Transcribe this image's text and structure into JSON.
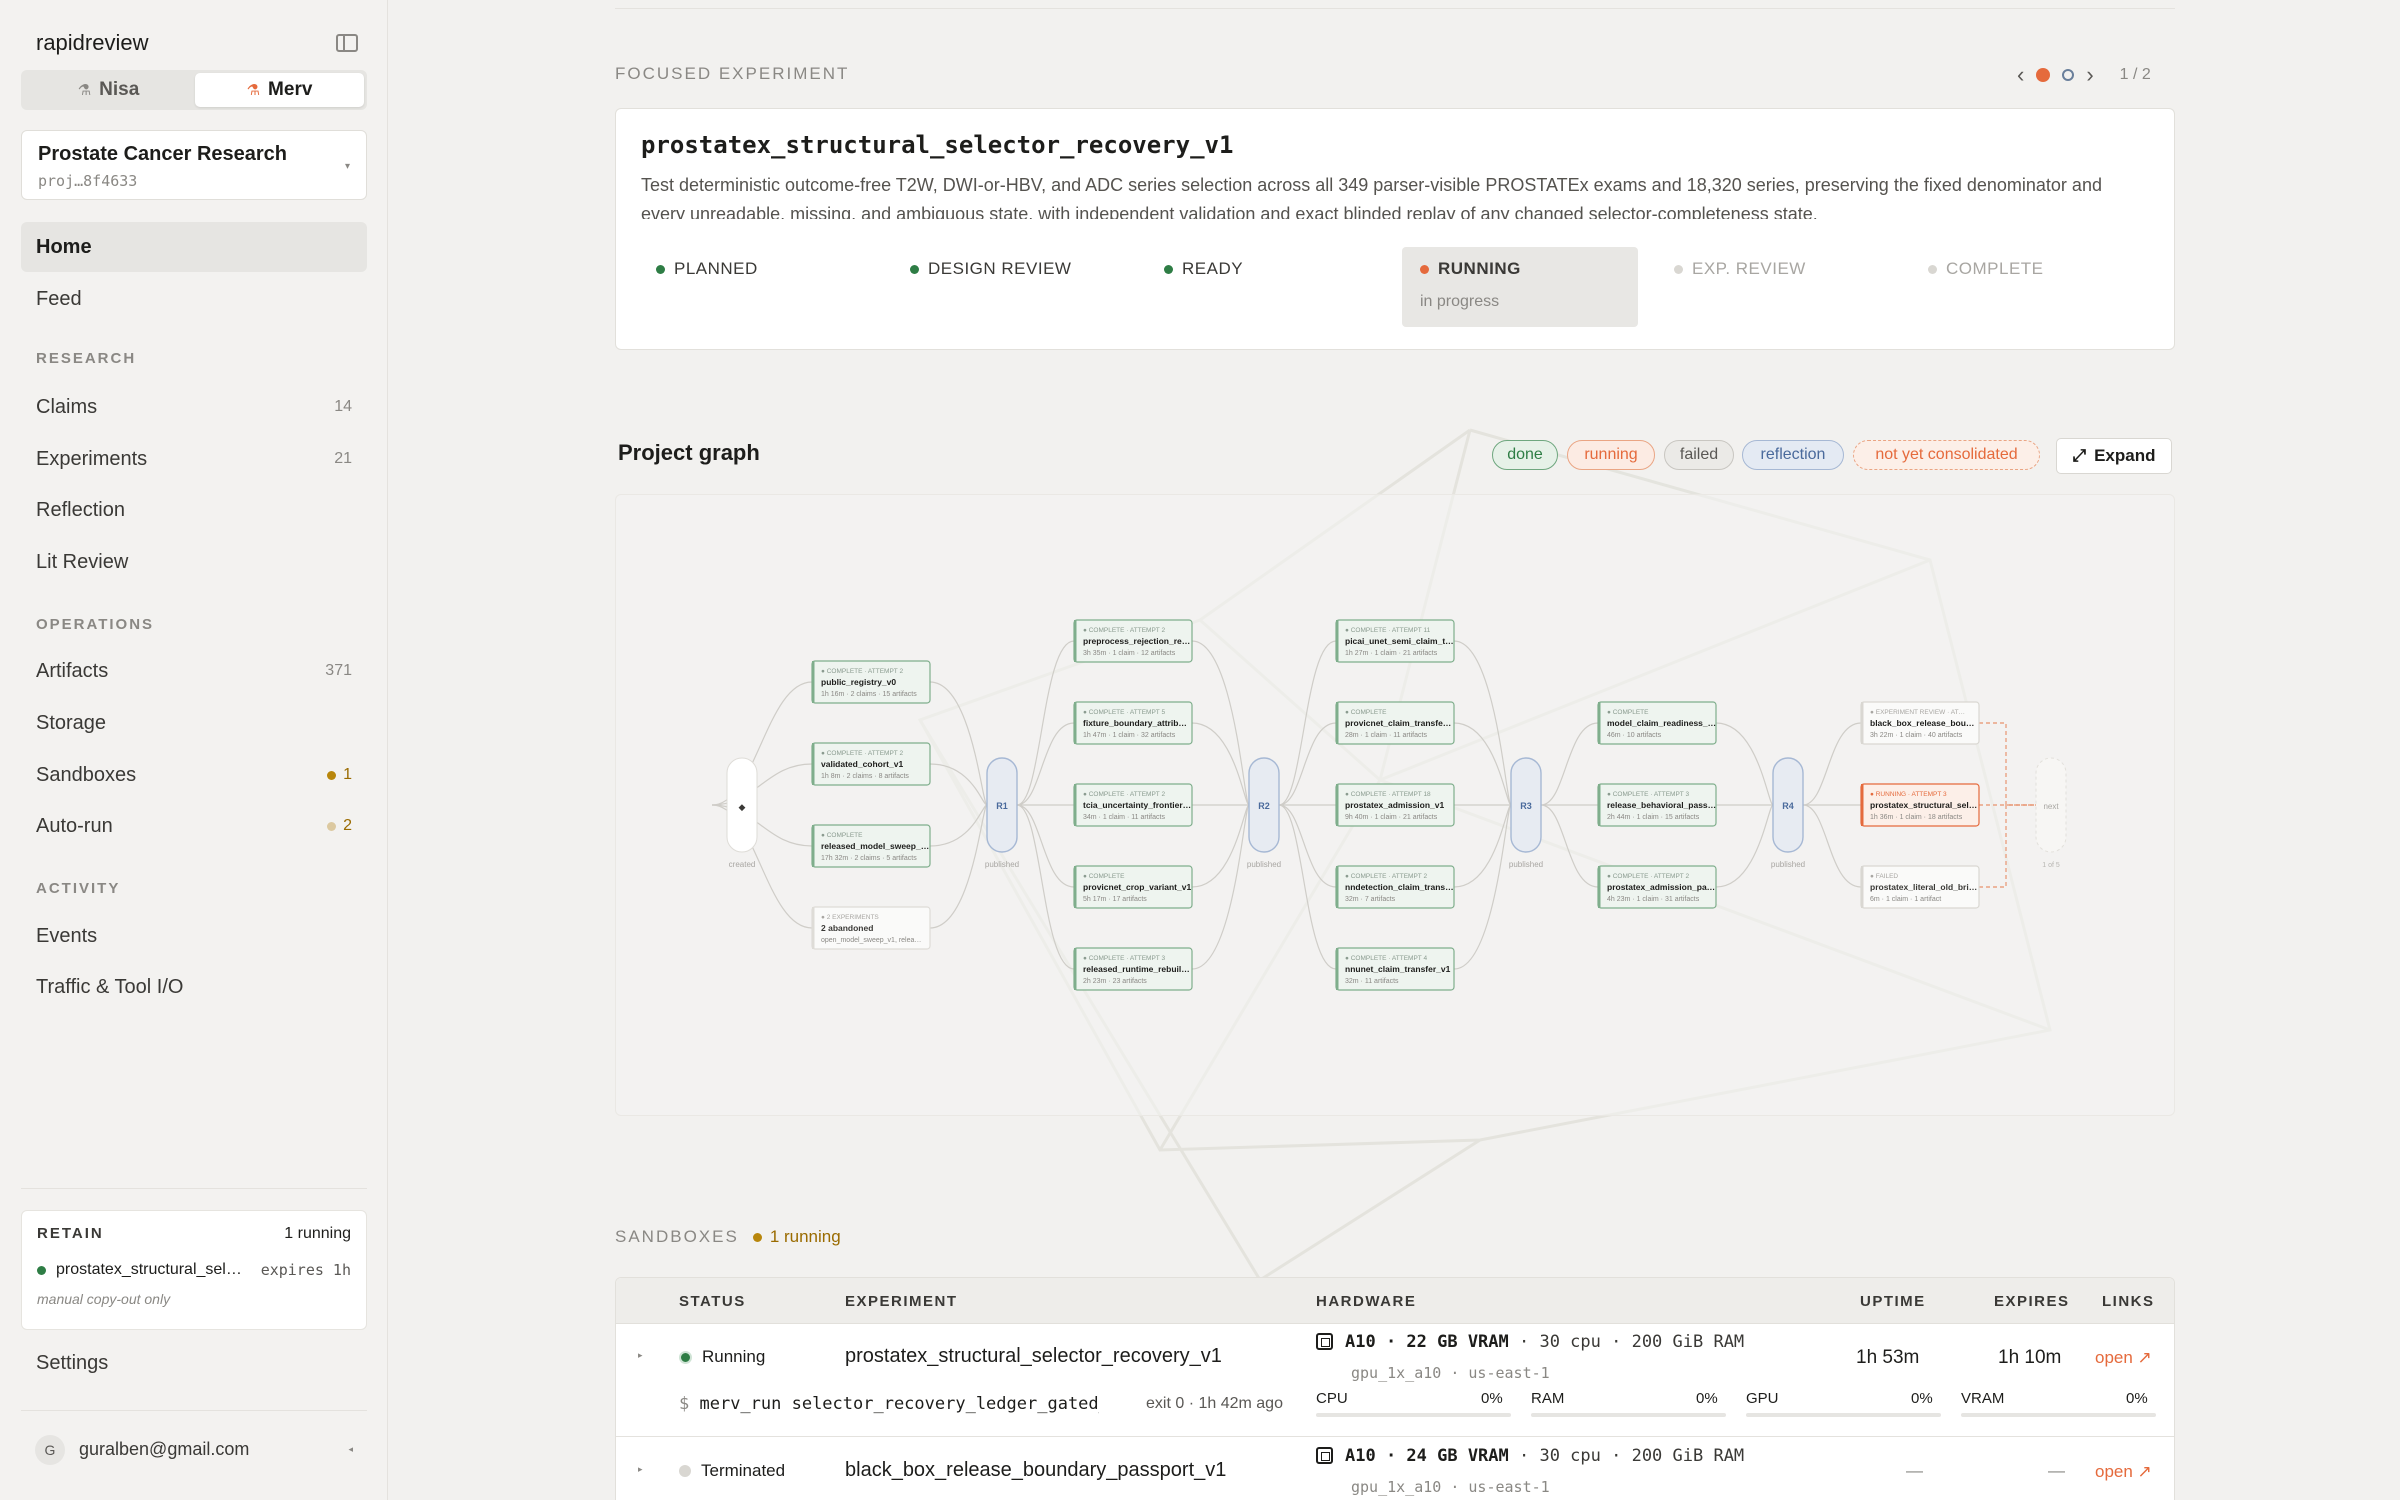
{
  "app": {
    "brand": "rapidreview"
  },
  "profiles": [
    {
      "label": "Nisa",
      "active": false
    },
    {
      "label": "Merv",
      "active": true
    }
  ],
  "project": {
    "name": "Prostate Cancer Research",
    "id": "proj…8f4633"
  },
  "nav": {
    "home": "Home",
    "feed": "Feed",
    "research_label": "RESEARCH",
    "research": [
      {
        "label": "Claims",
        "count": "14"
      },
      {
        "label": "Experiments",
        "count": "21"
      },
      {
        "label": "Reflection",
        "count": ""
      },
      {
        "label": "Lit Review",
        "count": ""
      }
    ],
    "operations_label": "OPERATIONS",
    "operations": [
      {
        "label": "Artifacts",
        "count": "371"
      },
      {
        "label": "Storage",
        "count": ""
      },
      {
        "label": "Sandboxes",
        "count": "1"
      },
      {
        "label": "Auto-run",
        "count": "2"
      }
    ],
    "activity_label": "ACTIVITY",
    "activity": [
      {
        "label": "Events"
      },
      {
        "label": "Traffic & Tool I/O"
      }
    ]
  },
  "retain": {
    "label": "RETAIN",
    "status": "1 running",
    "item": "prostatex_structural_selector_recovery_v1",
    "expires": "expires 1h",
    "note": "manual copy-out only"
  },
  "settings": "Settings",
  "user": {
    "initial": "G",
    "email": "guralben@gmail.com"
  },
  "focused": {
    "eyebrow": "FOCUSED EXPERIMENT",
    "page": "1 / 2",
    "title": "prostatex_structural_selector_recovery_v1",
    "description": "Test deterministic outcome-free T2W, DWI-or-HBV, and ADC series selection across all 349 parser-visible PROSTATEx exams and 18,320 series, preserving the fixed denominator and every unreadable, missing, and ambiguous state, with independent validation and exact blinded replay of any changed selector-completeness state.",
    "stages": [
      {
        "label": "PLANNED",
        "state": "done"
      },
      {
        "label": "DESIGN REVIEW",
        "state": "done"
      },
      {
        "label": "READY",
        "state": "done"
      },
      {
        "label": "RUNNING",
        "state": "current",
        "sub": "in progress"
      },
      {
        "label": "EXP. REVIEW",
        "state": "future"
      },
      {
        "label": "COMPLETE",
        "state": "future"
      }
    ]
  },
  "graph": {
    "title": "Project graph",
    "legend": [
      "done",
      "running",
      "failed",
      "reflection",
      "not yet consolidated"
    ],
    "expand": "Expand",
    "start_label": "created",
    "rounds": [
      {
        "label": "R1",
        "sub": "published"
      },
      {
        "label": "R2",
        "sub": "published"
      },
      {
        "label": "R3",
        "sub": "published"
      },
      {
        "label": "R4",
        "sub": "published"
      }
    ],
    "next": {
      "label": "next",
      "sub": "1 of 5"
    },
    "columns": [
      [
        {
          "head": "COMPLETE · ATTEMPT 2",
          "name": "public_registry_v0",
          "meta": "1h 16m · 2 claims · 15 artifacts",
          "state": "done"
        },
        {
          "head": "COMPLETE · ATTEMPT 2",
          "name": "validated_cohort_v1",
          "meta": "1h 8m · 2 claims · 8 artifacts",
          "state": "done"
        },
        {
          "head": "COMPLETE",
          "name": "released_model_sweep_…",
          "meta": "17h 32m · 2 claims · 5 artifacts",
          "state": "done"
        },
        {
          "head": "2 EXPERIMENTS",
          "name": "2 abandoned",
          "meta": "open_model_sweep_v1, relea…",
          "state": "abandoned"
        }
      ],
      [
        {
          "head": "COMPLETE · ATTEMPT 2",
          "name": "preprocess_rejection_re…",
          "meta": "3h 35m · 1 claim · 12 artifacts",
          "state": "done"
        },
        {
          "head": "COMPLETE · ATTEMPT 5",
          "name": "fixture_boundary_attrib…",
          "meta": "1h 47m · 1 claim · 32 artifacts",
          "state": "done"
        },
        {
          "head": "COMPLETE · ATTEMPT 2",
          "name": "tcia_uncertainty_frontier…",
          "meta": "34m · 1 claim · 11 artifacts",
          "state": "done"
        },
        {
          "head": "COMPLETE",
          "name": "provicnet_crop_variant_v1",
          "meta": "5h 17m · 17 artifacts",
          "state": "done"
        },
        {
          "head": "COMPLETE · ATTEMPT 3",
          "name": "released_runtime_rebuil…",
          "meta": "2h 23m · 23 artifacts",
          "state": "done"
        }
      ],
      [
        {
          "head": "COMPLETE · ATTEMPT 11",
          "name": "picai_unet_semi_claim_t…",
          "meta": "1h 27m · 1 claim · 21 artifacts",
          "state": "done"
        },
        {
          "head": "COMPLETE",
          "name": "provicnet_claim_transfe…",
          "meta": "28m · 1 claim · 11 artifacts",
          "state": "done"
        },
        {
          "head": "COMPLETE · ATTEMPT 18",
          "name": "prostatex_admission_v1",
          "meta": "9h 40m · 1 claim · 21 artifacts",
          "state": "done"
        },
        {
          "head": "COMPLETE · ATTEMPT 2",
          "name": "nndetection_claim_trans…",
          "meta": "32m · 7 artifacts",
          "state": "done"
        },
        {
          "head": "COMPLETE · ATTEMPT 4",
          "name": "nnunet_claim_transfer_v1",
          "meta": "32m · 11 artifacts",
          "state": "done"
        }
      ],
      [
        {
          "head": "COMPLETE",
          "name": "model_claim_readiness_…",
          "meta": "46m · 10 artifacts",
          "state": "done"
        },
        {
          "head": "COMPLETE · ATTEMPT 3",
          "name": "release_behavioral_pass…",
          "meta": "2h 44m · 1 claim · 15 artifacts",
          "state": "done"
        },
        {
          "head": "COMPLETE · ATTEMPT 2",
          "name": "prostatex_admission_pa…",
          "meta": "4h 23m · 1 claim · 31 artifacts",
          "state": "done"
        }
      ],
      [
        {
          "head": "EXPERIMENT REVIEW · AT…",
          "name": "black_box_release_bou…",
          "meta": "3h 22m · 1 claim · 40 artifacts",
          "state": "review"
        },
        {
          "head": "RUNNING · ATTEMPT 3",
          "name": "prostatex_structural_sel…",
          "meta": "1h 36m · 1 claim · 18 artifacts",
          "state": "running"
        },
        {
          "head": "FAILED",
          "name": "prostatex_literal_old_bri…",
          "meta": "6m · 1 claim · 1 artifact",
          "state": "failed"
        }
      ]
    ]
  },
  "sandboxes": {
    "eyebrow": "SANDBOXES",
    "running": "1 running",
    "headers": [
      "STATUS",
      "EXPERIMENT",
      "HARDWARE",
      "UPTIME",
      "EXPIRES",
      "LINKS"
    ],
    "rows": [
      {
        "status": "Running",
        "experiment": "prostatex_structural_selector_recovery_v1",
        "hardware": "A10 · 22 GB VRAM",
        "hardware_extra": " · 30 cpu · 200 GiB RAM",
        "hardware_sub": "gpu_1x_a10 · us-east-1",
        "uptime": "1h 53m",
        "expires": "1h 10m",
        "link": "open ↗",
        "command": "merv_run selector_recovery_ledger_gated_v…",
        "exit": "exit 0 · 1h 42m ago",
        "metrics": [
          {
            "label": "CPU",
            "value": "0%",
            "level": 0
          },
          {
            "label": "RAM",
            "value": "0%",
            "level": 0
          },
          {
            "label": "GPU",
            "value": "0%",
            "level": 0
          },
          {
            "label": "VRAM",
            "value": "0%",
            "level": 0
          }
        ]
      },
      {
        "status": "Terminated",
        "experiment": "black_box_release_boundary_passport_v1",
        "hardware": "A10 · 24 GB VRAM",
        "hardware_extra": " · 30 cpu · 200 GiB RAM",
        "hardware_sub": "gpu_1x_a10 · us-east-1",
        "uptime": "—",
        "expires": "—",
        "link": "open ↗"
      }
    ]
  },
  "colors": {
    "accent": "#e56a3c",
    "done": "#2e7d45",
    "running": "#e56a3c",
    "reflection": "#5b7bb0",
    "warn": "#b8860b",
    "failed": "#8a8884"
  }
}
